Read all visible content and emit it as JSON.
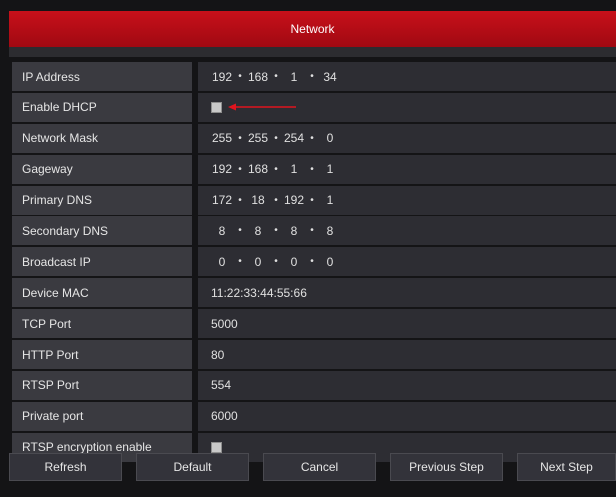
{
  "window": {
    "title": "Network"
  },
  "rows": [
    {
      "label": "IP Address",
      "type": "ip",
      "octets": [
        "192",
        "168",
        "1",
        "34"
      ]
    },
    {
      "label": "Enable DHCP",
      "type": "checkbox",
      "checked": false
    },
    {
      "label": "Network Mask",
      "type": "ip",
      "octets": [
        "255",
        "255",
        "254",
        "0"
      ]
    },
    {
      "label": "Gageway",
      "type": "ip",
      "octets": [
        "192",
        "168",
        "1",
        "1"
      ]
    },
    {
      "label": "Primary DNS",
      "type": "ip",
      "octets": [
        "172",
        "18",
        "192",
        "1"
      ]
    },
    {
      "label": "Secondary DNS",
      "type": "ip",
      "octets": [
        "8",
        "8",
        "8",
        "8"
      ]
    },
    {
      "label": "Broadcast IP",
      "type": "ip",
      "octets": [
        "0",
        "0",
        "0",
        "0"
      ]
    },
    {
      "label": "Device MAC",
      "type": "text",
      "value": "11:22:33:44:55:66"
    },
    {
      "label": "TCP Port",
      "type": "text",
      "value": "5000"
    },
    {
      "label": "HTTP Port",
      "type": "text",
      "value": "80"
    },
    {
      "label": "RTSP Port",
      "type": "text",
      "value": "554"
    },
    {
      "label": "Private port",
      "type": "text",
      "value": "6000"
    },
    {
      "label": "RTSP encryption enable",
      "type": "checkbox",
      "checked": false
    }
  ],
  "buttons": {
    "refresh": "Refresh",
    "default": "Default",
    "cancel": "Cancel",
    "previous": "Previous Step",
    "next": "Next Step"
  },
  "colors": {
    "title_bar": "#b70d16",
    "annotation_arrow": "#e0141e"
  }
}
